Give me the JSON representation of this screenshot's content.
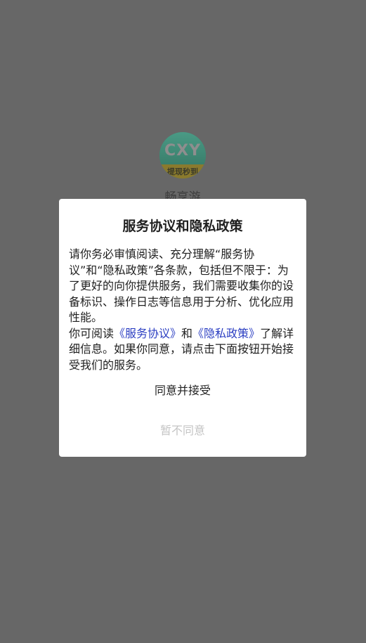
{
  "app": {
    "name": "畅享游",
    "logo_text": "CXY",
    "logo_band_text": "提现秒到"
  },
  "dialog": {
    "title": "服务协议和隐私政策",
    "body_para1": "请你务必审慎阅读、充分理解“服务协议”和“隐私政策”各条款，包括但不限于：为了更好的向你提供服务，我们需要收集你的设备标识、操作日志等信息用于分析、优化应用性能。",
    "body_para2_prefix": "你可阅读",
    "service_agreement_link": "《服务协议》",
    "body_para2_and": "和",
    "privacy_policy_link": "《隐私政策》",
    "body_para2_suffix": "了解详细信息。如果你同意，请点击下面按钮开始接受我们的服务。",
    "agree_label": "同意并接受",
    "decline_label": "暂不同意"
  },
  "colors": {
    "backdrop": "#676767",
    "link": "#2b3ec2",
    "decline_text": "#c4c4c4"
  }
}
